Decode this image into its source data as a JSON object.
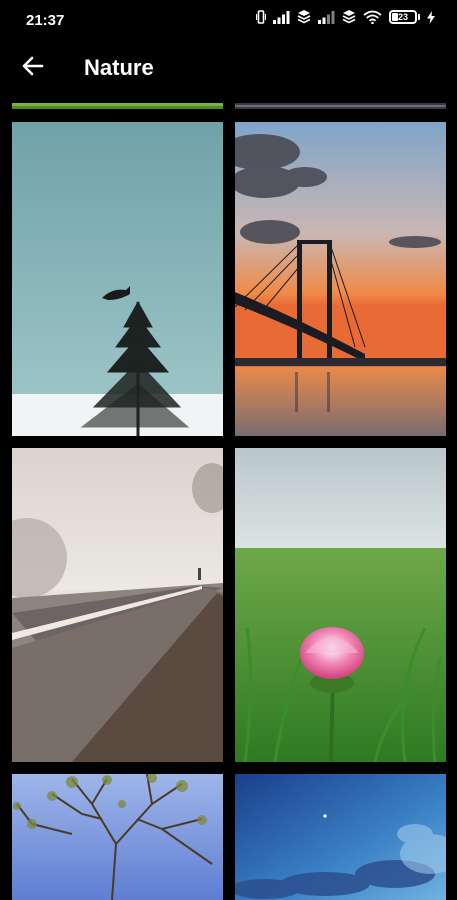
{
  "status_bar": {
    "time": "21:37",
    "battery_level": "23",
    "icons": [
      "vibrate-icon",
      "signal-icon",
      "data-icon",
      "signal-icon",
      "data-icon",
      "wifi-icon",
      "battery-icon",
      "charging-icon"
    ]
  },
  "app_bar": {
    "title": "Nature",
    "back_icon": "arrow-left-icon"
  },
  "gallery": {
    "images": [
      {
        "subject": "tree-with-bird"
      },
      {
        "subject": "bridge-sunset"
      },
      {
        "subject": "foggy-road"
      },
      {
        "subject": "pink-flower-grass"
      },
      {
        "subject": "bare-tree-blue-sky"
      },
      {
        "subject": "blue-sky-clouds"
      }
    ]
  },
  "colors": {
    "background": "#000000",
    "text": "#ffffff"
  }
}
